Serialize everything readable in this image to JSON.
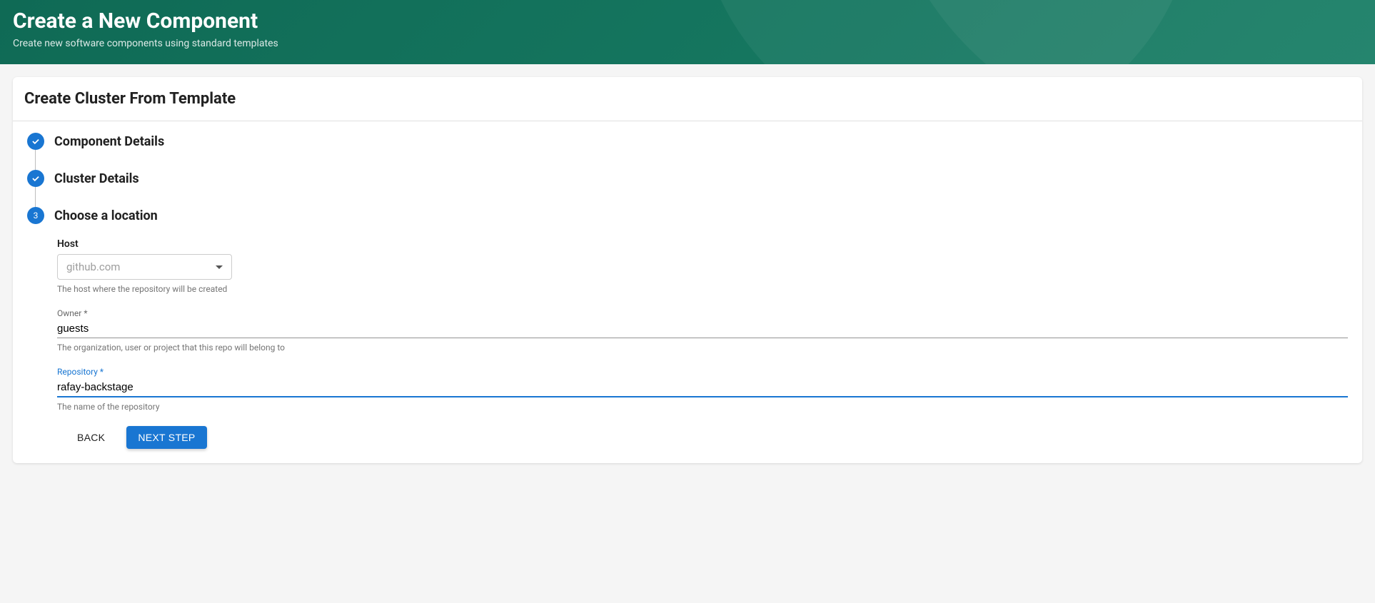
{
  "header": {
    "title": "Create a New Component",
    "subtitle": "Create new software components using standard templates"
  },
  "card": {
    "title": "Create Cluster From Template"
  },
  "steps": {
    "s1": {
      "title": "Component Details"
    },
    "s2": {
      "title": "Cluster Details"
    },
    "s3": {
      "title": "Choose a location",
      "number": "3"
    }
  },
  "form": {
    "host": {
      "label": "Host",
      "placeholder": "github.com",
      "help": "The host where the repository will be created"
    },
    "owner": {
      "label": "Owner",
      "value": "guests",
      "help": "The organization, user or project that this repo will belong to"
    },
    "repository": {
      "label": "Repository",
      "value": "rafay-backstage",
      "help": "The name of the repository"
    }
  },
  "actions": {
    "back": "Back",
    "next": "Next Step"
  }
}
